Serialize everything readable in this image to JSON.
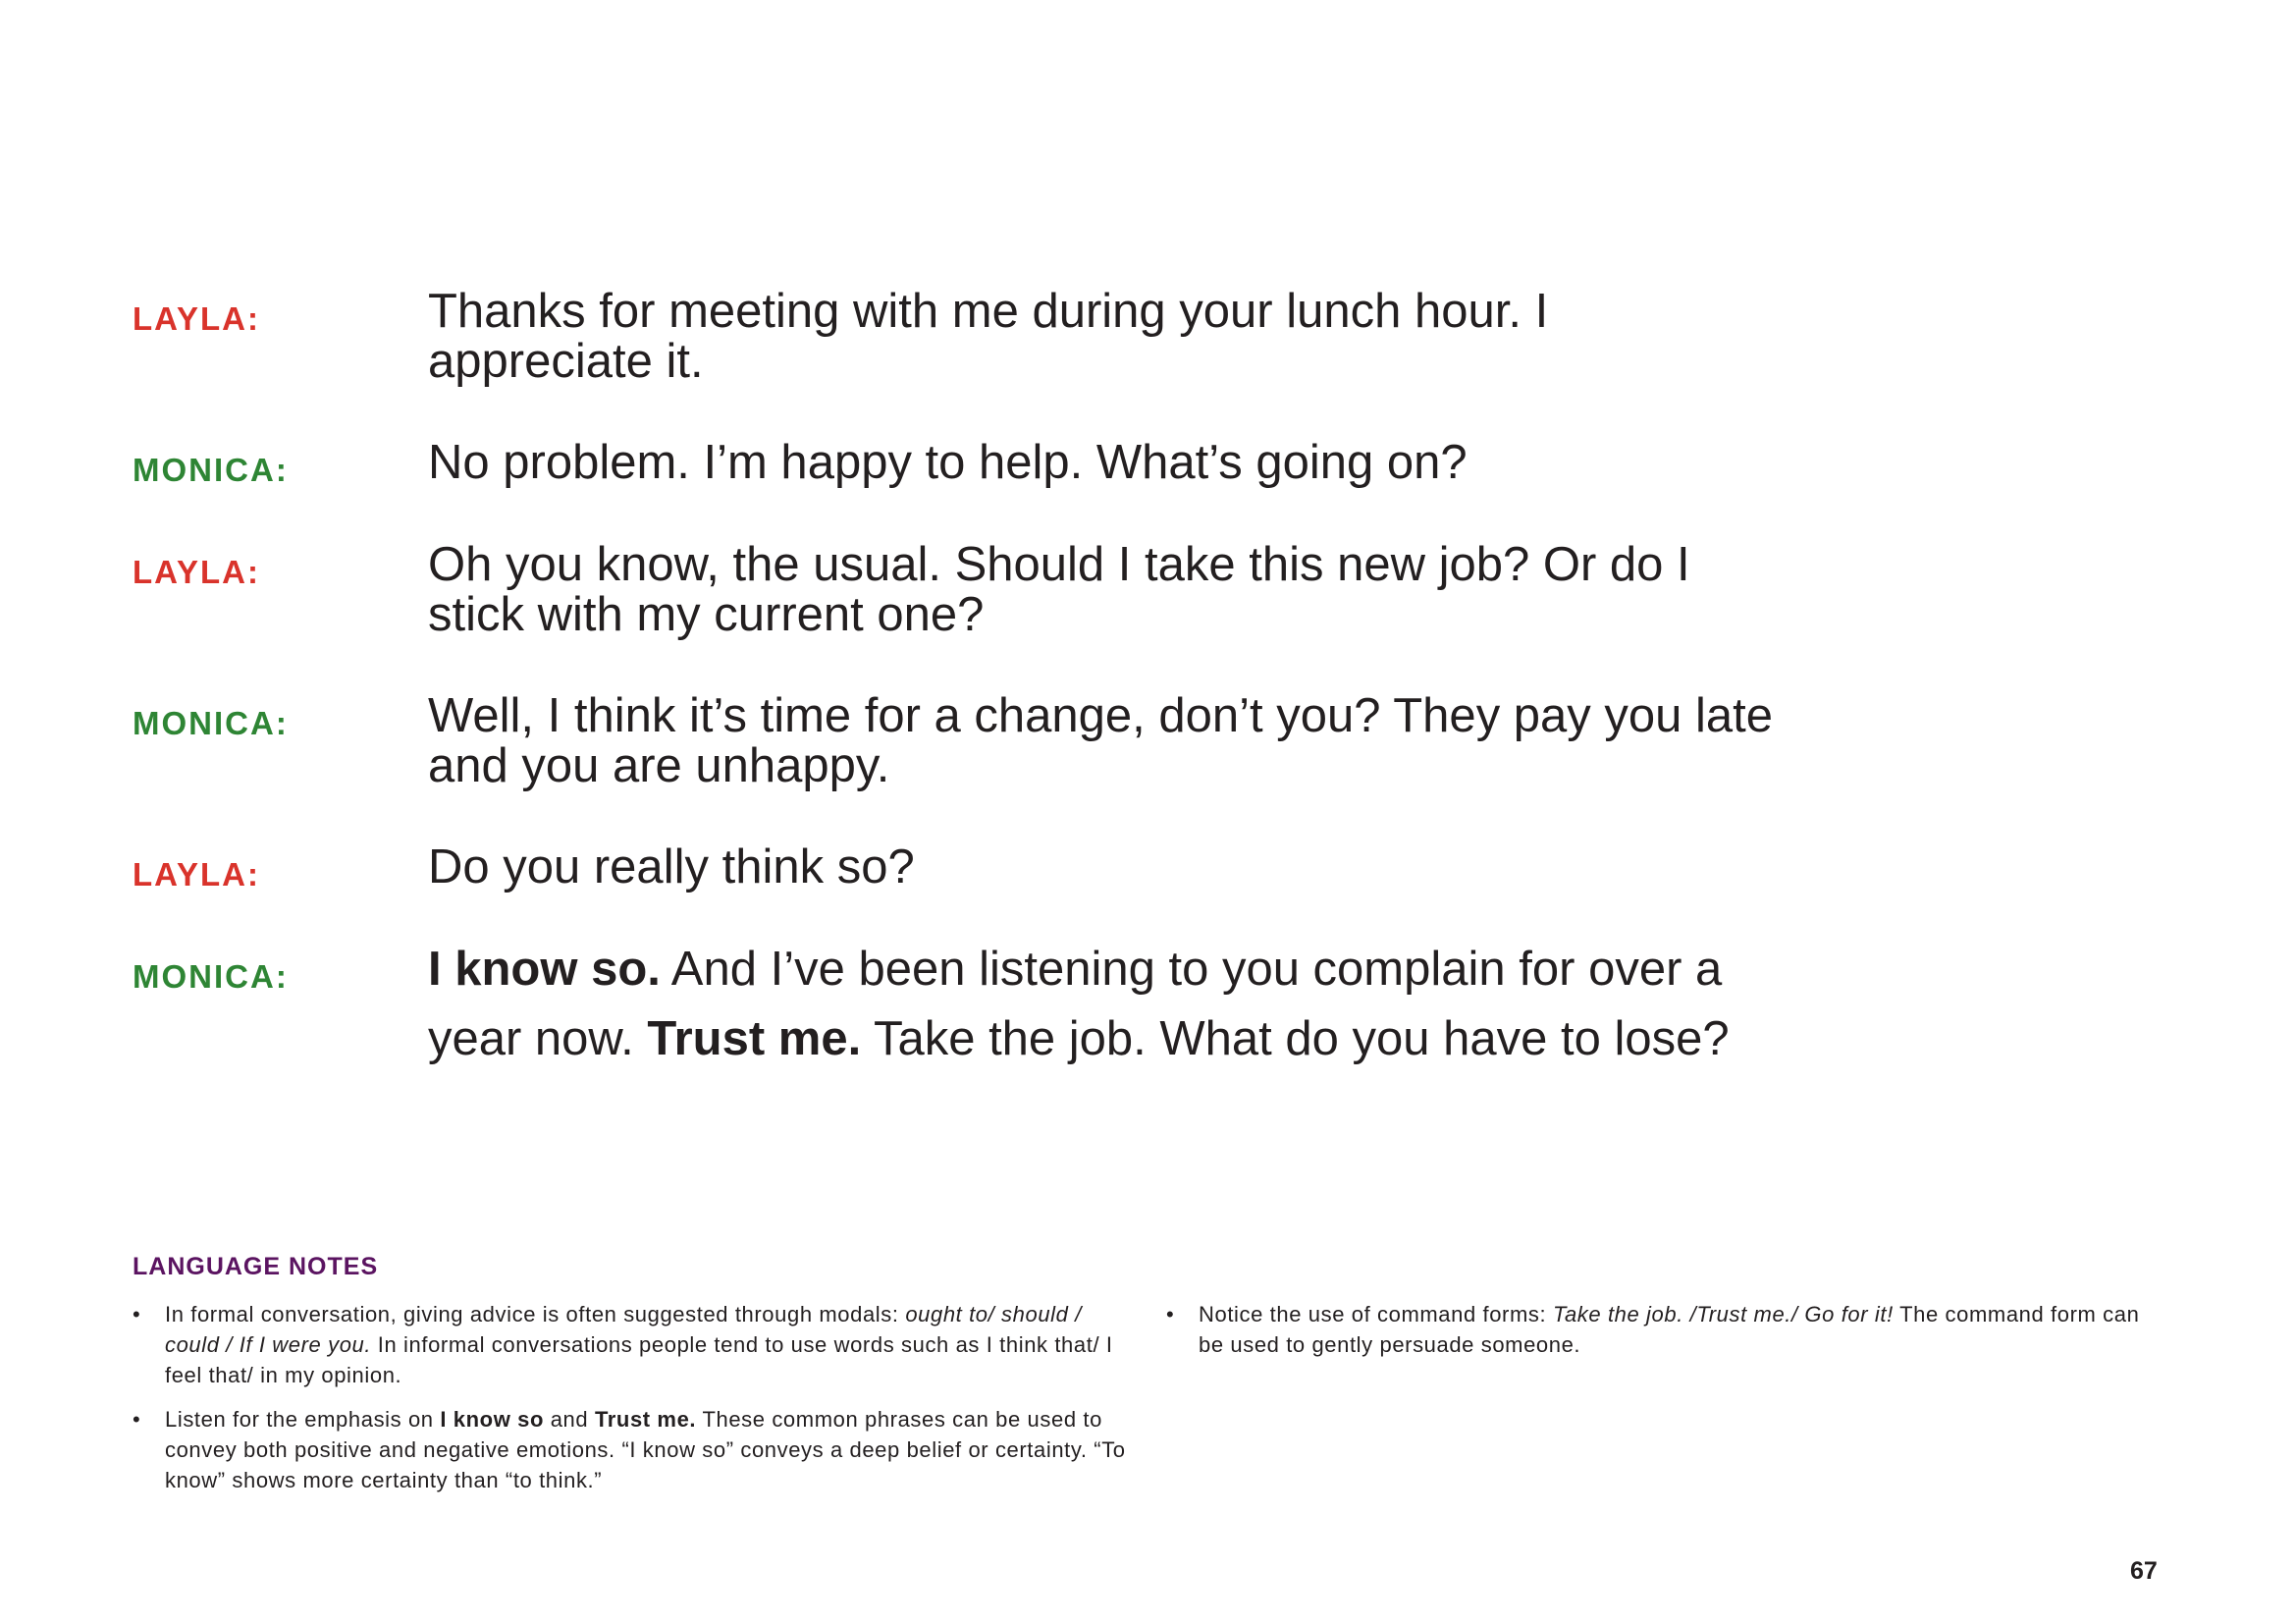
{
  "dialogue": [
    {
      "speaker": "LAYLA:",
      "line1": "Thanks for meeting with me during your lunch hour. I",
      "line2": "appreciate it."
    },
    {
      "speaker": "MONICA:",
      "line1": "No problem. I’m happy to help. What’s going on?"
    },
    {
      "speaker": "LAYLA:",
      "line1": "Oh you know, the usual. Should I take this new job? Or do I",
      "line2": "stick with my current one?"
    },
    {
      "speaker": "MONICA:",
      "line1": "Well, I think it’s time for a change, don’t you? They pay you late",
      "line2": "and you are unhappy."
    },
    {
      "speaker": "LAYLA:",
      "line1": "Do you really think so?"
    },
    {
      "speaker": "MONICA:",
      "bold1": "I know so.",
      "text1": " And I’ve been listening to you complain for over a",
      "text2": "year now. ",
      "bold2": "Trust me.",
      "text3": " Take the job. What do you have to lose?"
    }
  ],
  "colors": {
    "layla": "#d9332b",
    "monica": "#2e8534",
    "notes_title": "#5b1461",
    "text": "#231f20"
  },
  "notes": {
    "title": "LANGUAGE NOTES",
    "bullet": "•",
    "n1": {
      "a": "In formal conversation, giving advice is often suggested through modals: ",
      "i": "ought to/ should / could / If I were you.",
      "b": " In informal conversations people tend to use words such as I think that/ I feel that/ in my opinion."
    },
    "n2": {
      "a": "Listen for the emphasis on ",
      "b1": "I know so",
      "c": " and ",
      "b2": "Trust me.",
      "d": " These common phrases can be used to convey both positive and negative emotions. “I know so” conveys a deep belief or certainty. “To know” shows more certainty than “to think.”"
    },
    "n3": {
      "a": "Notice the use of command forms: ",
      "i": "Take the job. /Trust me./ Go for it!",
      "b": " The command form can be used to gently persuade someone."
    }
  },
  "page_number": "67"
}
